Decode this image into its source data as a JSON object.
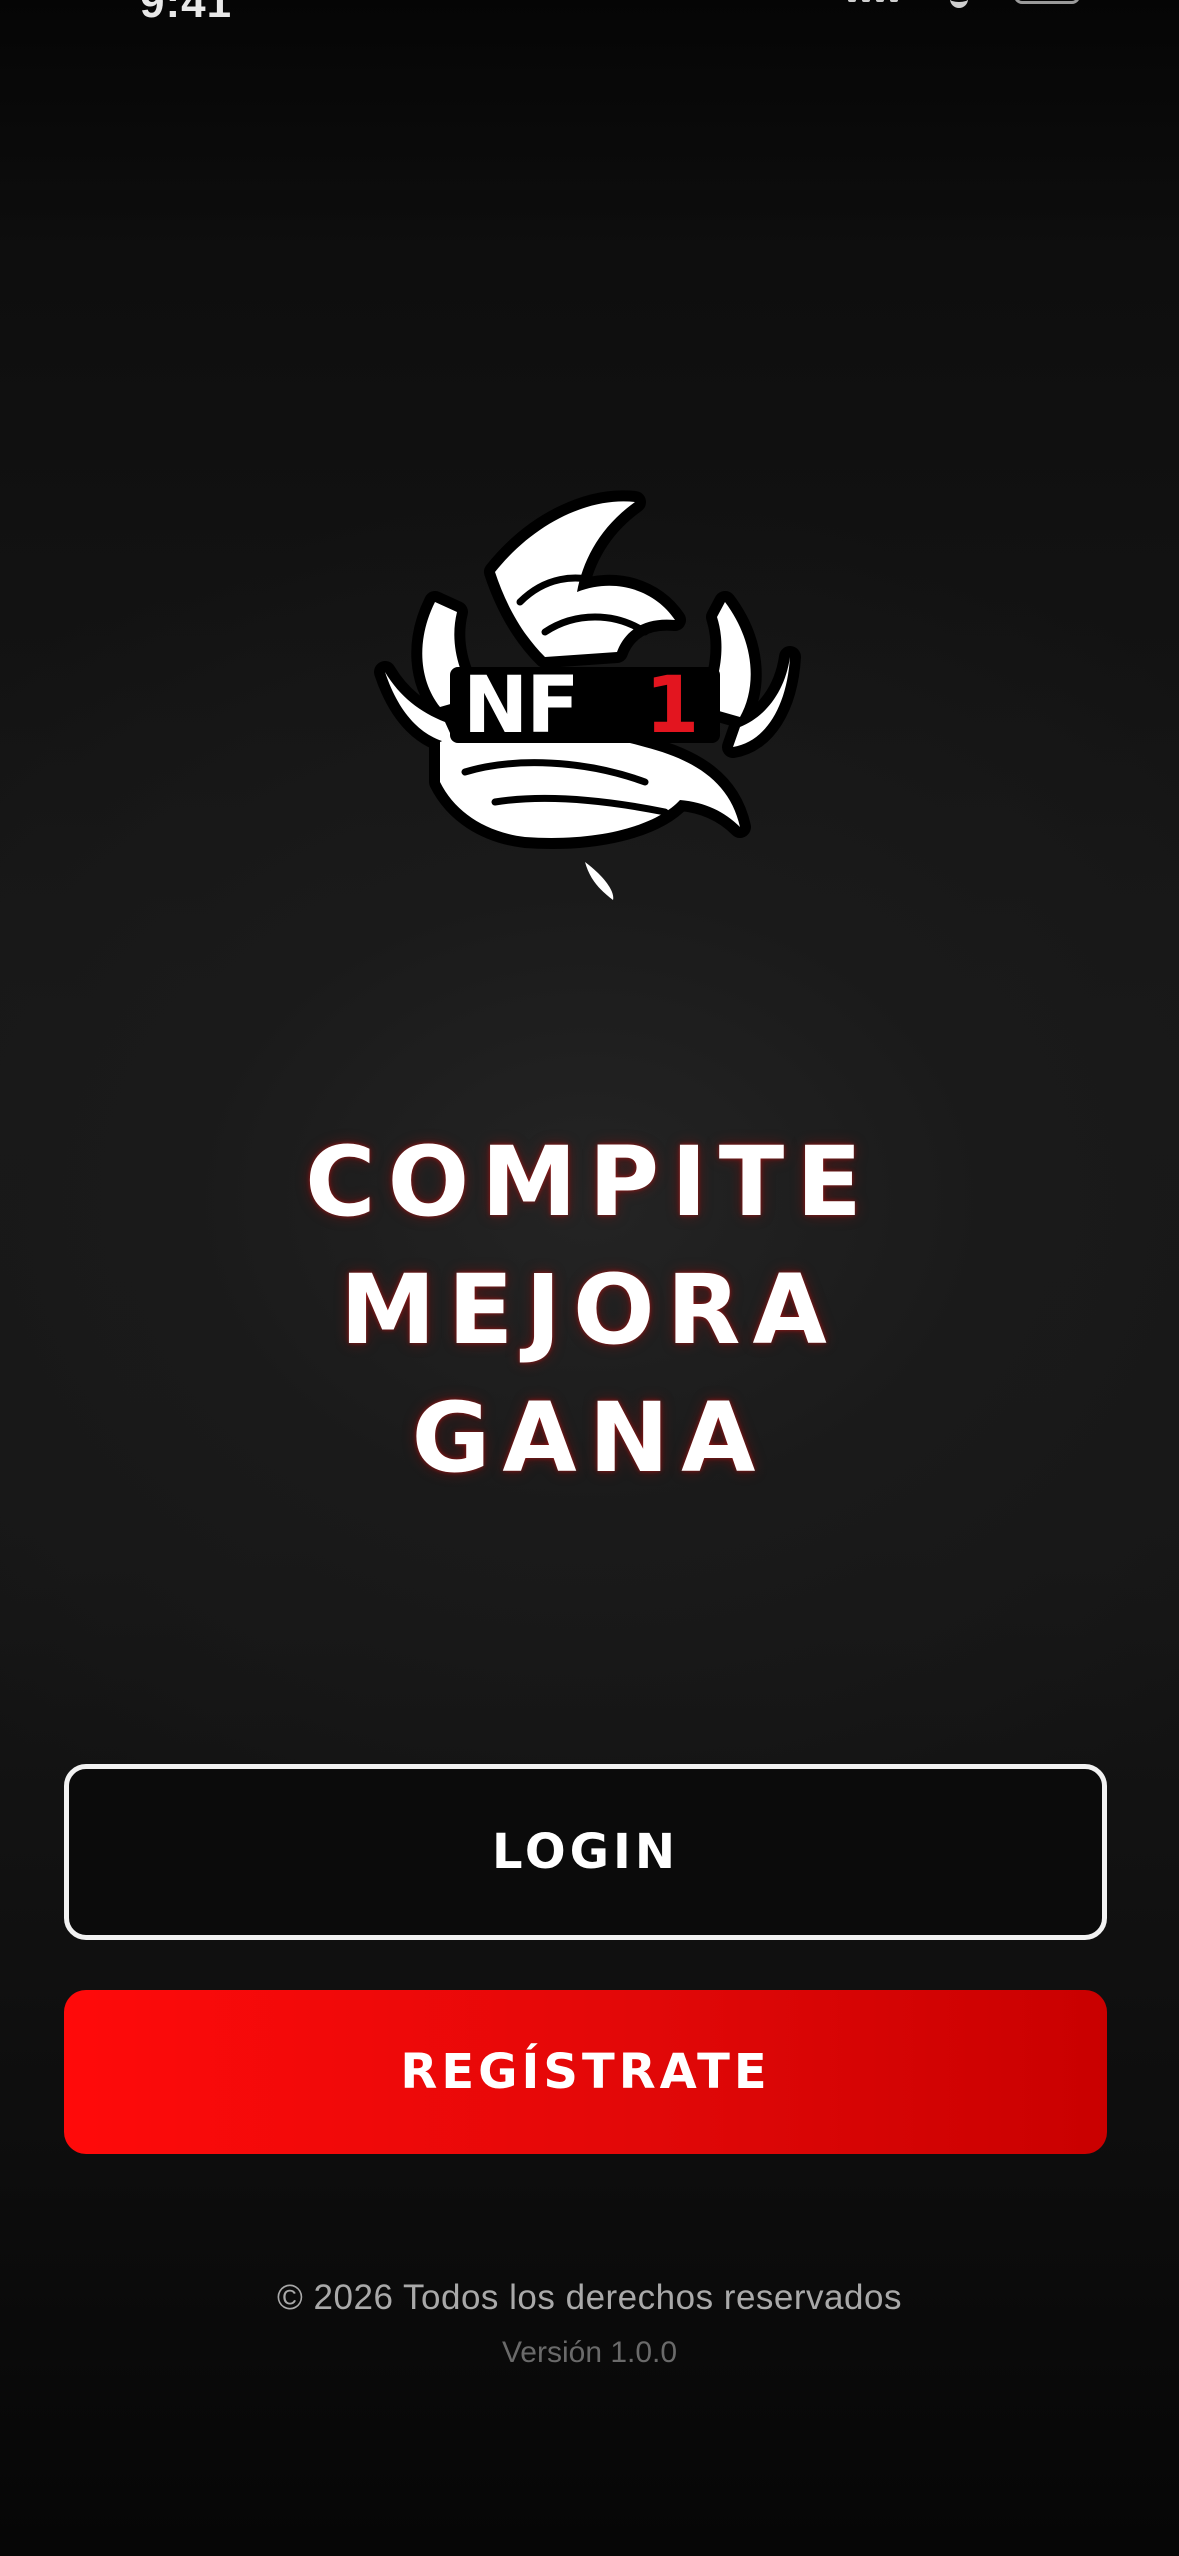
{
  "status_bar": {
    "time": "9:41",
    "battery_color": "#34c759"
  },
  "logo": {
    "text_white": "NF",
    "text_red": "1",
    "accent_color": "#e3151f"
  },
  "slogan": {
    "line1": "COMPITE",
    "line2": "MEJORA",
    "line3": "GANA"
  },
  "actions": {
    "login_label": "LOGIN",
    "register_label": "REGÍSTRATE",
    "register_color": "#ff0a0a"
  },
  "footer": {
    "copyright": "© 2026 Todos los derechos reservados",
    "version": "Versión 1.0.0"
  }
}
